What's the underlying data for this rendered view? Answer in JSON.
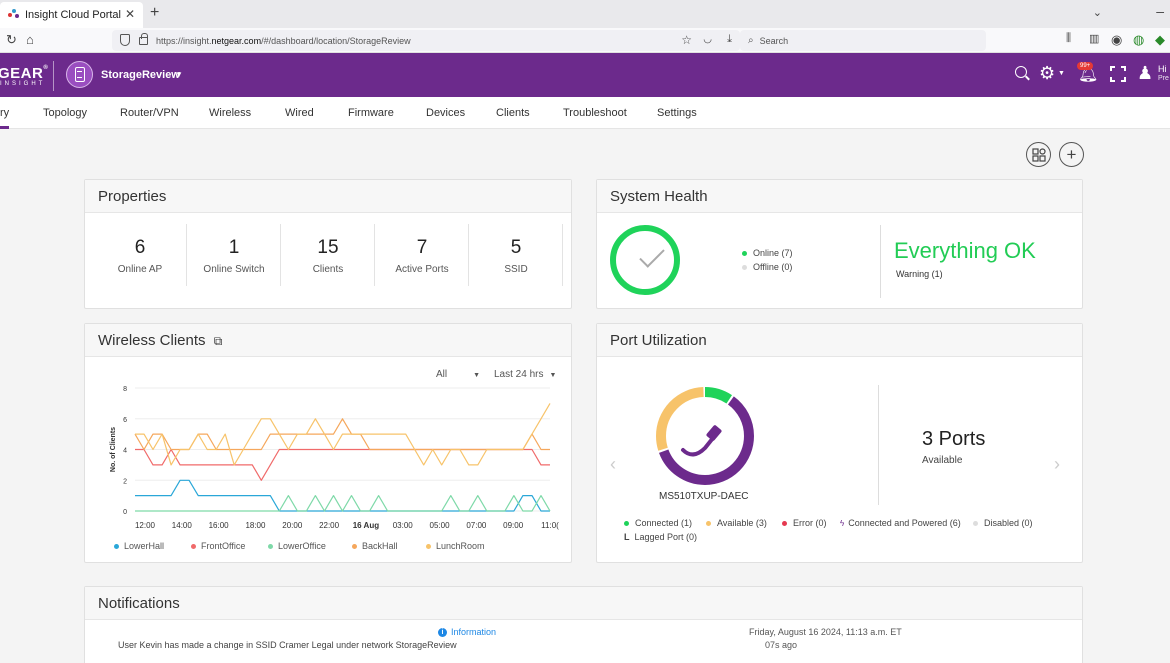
{
  "browser": {
    "tab_title": "Insight Cloud Portal",
    "tab_close": "✕",
    "new_tab": "+",
    "url_host_prefix": "https://insight.",
    "url_host": "netgear.com",
    "url_path": "/#/dashboard/location/StorageReview",
    "search_placeholder": "Search"
  },
  "header": {
    "logo_main": "GEAR",
    "logo_tm": "®",
    "logo_sub": "INSIGHT",
    "location_name": "StorageReview",
    "notification_count": "99+",
    "greeting": "Hi",
    "greeting_sub": "Pre"
  },
  "tabs": [
    {
      "label": "ry"
    },
    {
      "label": "Topology"
    },
    {
      "label": "Router/VPN"
    },
    {
      "label": "Wireless"
    },
    {
      "label": "Wired"
    },
    {
      "label": "Firmware"
    },
    {
      "label": "Devices"
    },
    {
      "label": "Clients"
    },
    {
      "label": "Troubleshoot"
    },
    {
      "label": "Settings"
    }
  ],
  "properties": {
    "title": "Properties",
    "items": [
      {
        "value": "6",
        "label": "Online AP"
      },
      {
        "value": "1",
        "label": "Online Switch"
      },
      {
        "value": "15",
        "label": "Clients"
      },
      {
        "value": "7",
        "label": "Active Ports"
      },
      {
        "value": "5",
        "label": "SSID"
      }
    ]
  },
  "system_health": {
    "title": "System Health",
    "online": "Online (7)",
    "offline": "Offline (0)",
    "status": "Everything OK",
    "warning": "Warning (1)",
    "colors": {
      "ok": "#22cc55",
      "online": "#1fd35a",
      "offline": "#dddddd"
    }
  },
  "wireless_clients": {
    "title": "Wireless Clients",
    "filter": "All",
    "range": "Last 24 hrs"
  },
  "chart_data": {
    "type": "line",
    "title": "",
    "xlabel": "",
    "ylabel": "No. of Clients",
    "ylim": [
      0,
      8
    ],
    "yticks": [
      "0",
      "2",
      "4",
      "6",
      "8"
    ],
    "xtick_labels": [
      "12:00",
      "14:00",
      "16:00",
      "18:00",
      "20:00",
      "22:00",
      "16 Aug",
      "03:00",
      "05:00",
      "07:00",
      "09:00",
      "11:0("
    ],
    "x_count": 47,
    "series": [
      {
        "name": "LowerHall",
        "color": "#2aa7d8",
        "values": [
          1,
          1,
          1,
          1,
          1,
          2,
          2,
          1,
          1,
          1,
          1,
          1,
          1,
          1,
          1,
          1,
          0,
          0,
          0,
          0,
          0,
          0,
          0,
          0,
          0,
          0,
          0,
          0,
          0,
          0,
          0,
          0,
          0,
          0,
          0,
          0,
          0,
          0,
          0,
          0,
          0,
          0,
          0,
          1,
          1,
          0,
          0
        ]
      },
      {
        "name": "FrontOffice",
        "color": "#f06a6a",
        "values": [
          4,
          4,
          3,
          3,
          4,
          3,
          3,
          3,
          3,
          3,
          3,
          3,
          3,
          3,
          2,
          3,
          4,
          4,
          4,
          4,
          4,
          4,
          4,
          4,
          4,
          4,
          4,
          4,
          4,
          4,
          4,
          4,
          4,
          4,
          4,
          4,
          4,
          4,
          4,
          4,
          4,
          4,
          4,
          4,
          4,
          3,
          3
        ]
      },
      {
        "name": "LowerOffice",
        "color": "#7ed9a8",
        "values": [
          0,
          0,
          0,
          0,
          0,
          0,
          0,
          0,
          0,
          0,
          0,
          0,
          0,
          0,
          0,
          0,
          0,
          1,
          0,
          0,
          1,
          0,
          1,
          0,
          1,
          0,
          0,
          1,
          0,
          0,
          0,
          0,
          0,
          0,
          0,
          1,
          0,
          0,
          1,
          0,
          0,
          0,
          1,
          0,
          0,
          1,
          0
        ]
      },
      {
        "name": "BackHall",
        "color": "#f5a75c",
        "values": [
          5,
          4,
          5,
          5,
          4,
          4,
          4,
          5,
          5,
          4,
          4,
          4,
          4,
          4,
          4,
          5,
          5,
          5,
          5,
          5,
          5,
          5,
          5,
          6,
          5,
          5,
          4,
          4,
          4,
          4,
          4,
          4,
          4,
          4,
          4,
          4,
          4,
          4,
          4,
          4,
          4,
          4,
          4,
          4,
          5,
          4,
          4
        ]
      },
      {
        "name": "LunchRoom",
        "color": "#f7c36a",
        "values": [
          5,
          5,
          4,
          5,
          3,
          4,
          4,
          5,
          4,
          4,
          5,
          3,
          4,
          5,
          6,
          6,
          5,
          4,
          5,
          5,
          6,
          5,
          4,
          5,
          5,
          5,
          5,
          5,
          5,
          5,
          5,
          4,
          3,
          4,
          3,
          4,
          4,
          3,
          3,
          4,
          4,
          4,
          4,
          4,
          5,
          6,
          7
        ]
      }
    ]
  },
  "port_utilization": {
    "title": "Port Utilization",
    "ports_count": "3 Ports",
    "ports_label": "Available",
    "device_name": "MS510TXUP-DAEC",
    "legend": {
      "connected": "Connected (1)",
      "available": "Available (3)",
      "error": "Error (0)",
      "powered": "Connected and Powered (6)",
      "disabled": "Disabled (0)",
      "lagged": "Lagged Port (0)"
    },
    "legend_lagged_mark": "L",
    "colors": {
      "connected": "#1fd35a",
      "available": "#f7c36a",
      "error": "#e53950",
      "powered": "#6c2a8c",
      "disabled": "#dddddd"
    },
    "donut": {
      "connected_fraction": 0.1,
      "available_fraction": 0.3,
      "powered_fraction": 0.6
    }
  },
  "notifications": {
    "title": "Notifications",
    "type": "Information",
    "message": "User Kevin has made a change in SSID Cramer Legal under network StorageReview",
    "date": "Friday, August 16 2024, 11:13 a.m. ET",
    "ago": "07s ago"
  }
}
